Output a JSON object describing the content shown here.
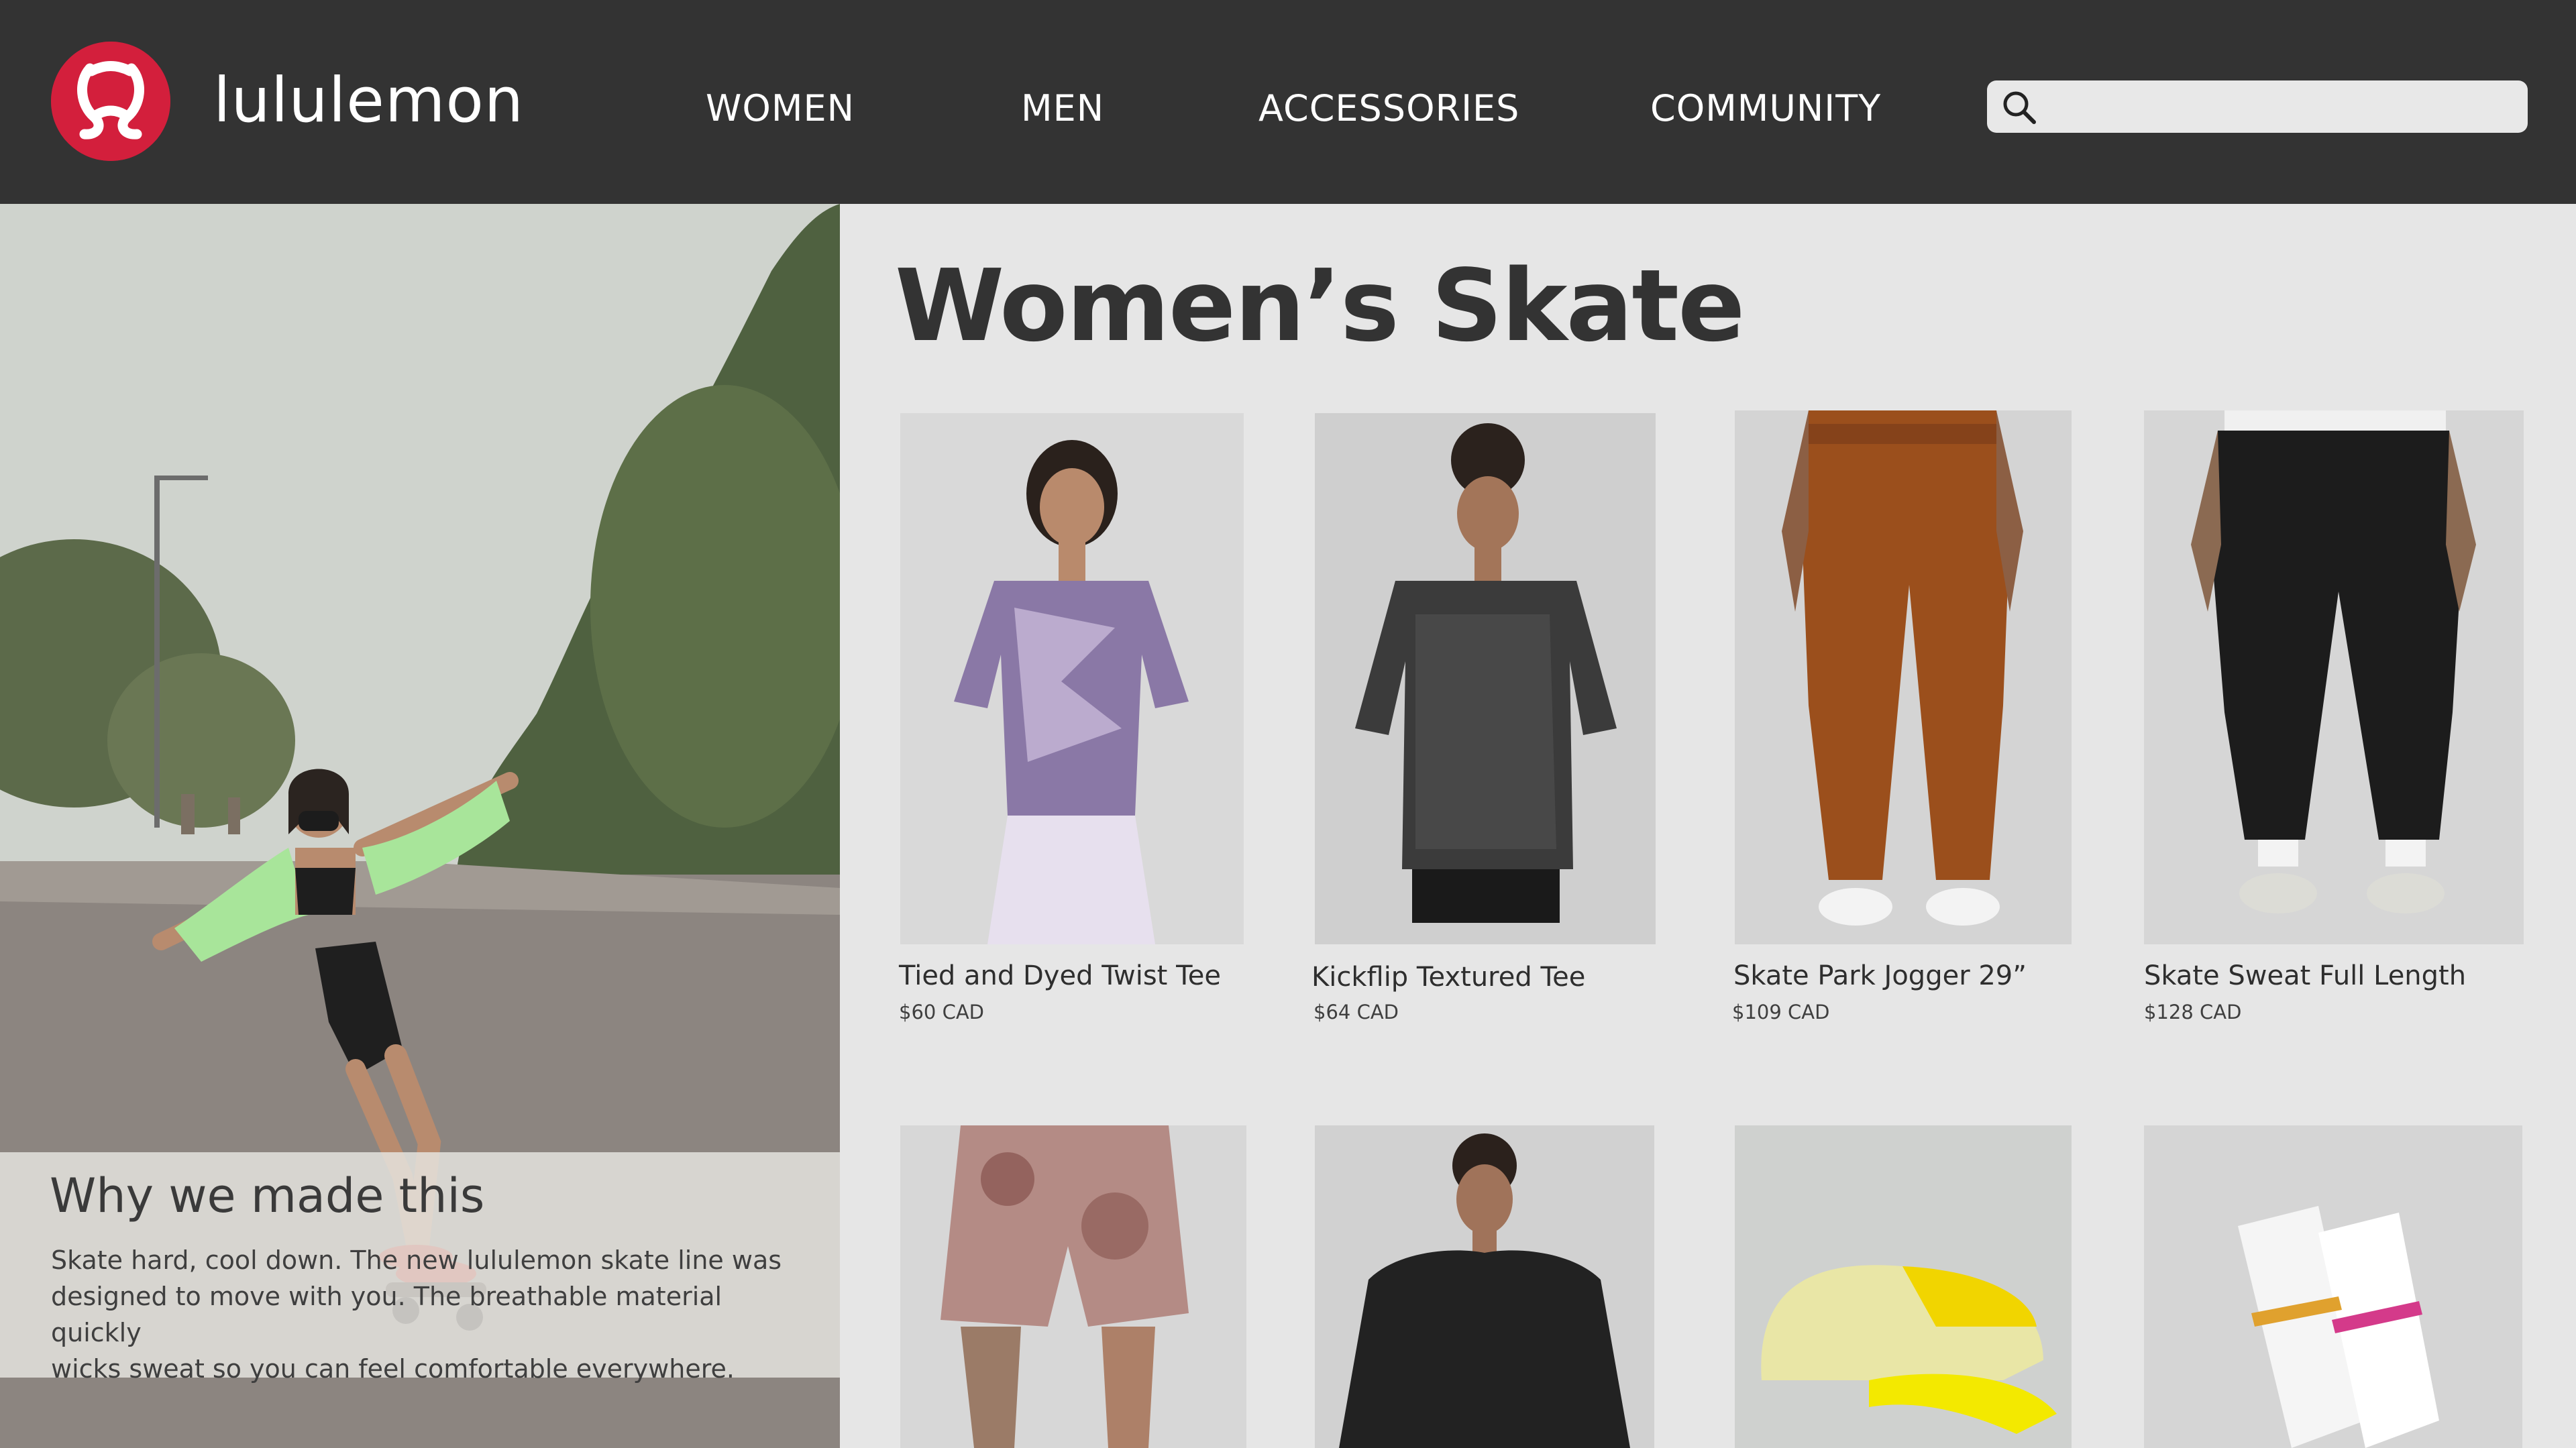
{
  "brand": {
    "name": "lululemon",
    "color": "#d31f3c"
  },
  "nav": {
    "items": [
      {
        "label": "WOMEN"
      },
      {
        "label": "MEN"
      },
      {
        "label": "ACCESSORIES"
      },
      {
        "label": "COMMUNITY"
      }
    ]
  },
  "search": {
    "placeholder": "",
    "icon": "search-icon"
  },
  "hero": {
    "why_title": "Why we made this",
    "why_lines": [
      "Skate hard, cool down. The new lululemon skate line was",
      "designed to move with you. The breathable material quickly",
      "wicks sweat so you can feel comfortable everywhere."
    ]
  },
  "page": {
    "title": "Women’s Skate"
  },
  "products": [
    {
      "name": "Tied and Dyed Twist Tee",
      "price": "$60 CAD"
    },
    {
      "name": "Kickflip Textured Tee",
      "price": "$64 CAD"
    },
    {
      "name": "Skate Park Jogger 29”",
      "price": "$109 CAD"
    },
    {
      "name": "Skate Sweat Full Length",
      "price": "$128 CAD"
    },
    {
      "name": "",
      "price": ""
    },
    {
      "name": "",
      "price": ""
    },
    {
      "name": "",
      "price": ""
    },
    {
      "name": "",
      "price": ""
    }
  ],
  "colors": {
    "header_bg": "#333333",
    "page_bg": "#e6e6e6",
    "accent": "#d31f3c"
  }
}
